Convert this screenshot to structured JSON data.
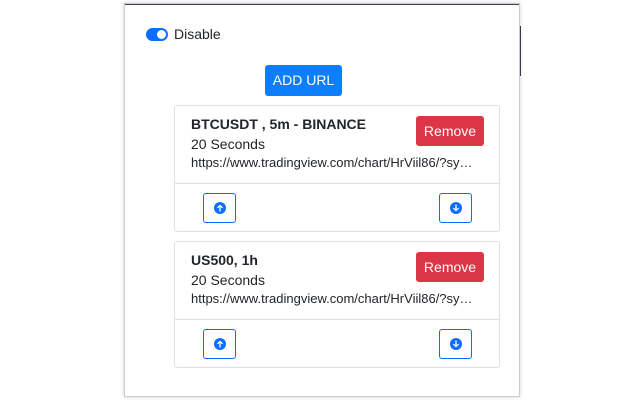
{
  "toggle": {
    "label": "Disable",
    "enabled": true,
    "color": "#0d6efd"
  },
  "add_url": {
    "label": "ADD URL",
    "color": "#0d7efd"
  },
  "cards": [
    {
      "title": "BTCUSDT , 5m - BINANCE",
      "interval": "20 Seconds",
      "url": "https://www.tradingview.com/chart/HrViil86/?sy…",
      "remove_label": "Remove",
      "up_icon": "arrow-up-circle-icon",
      "down_icon": "arrow-down-circle-icon"
    },
    {
      "title": "US500, 1h",
      "interval": "20 Seconds",
      "url": "https://www.tradingview.com/chart/HrViil86/?sy…",
      "remove_label": "Remove",
      "up_icon": "arrow-up-circle-icon",
      "down_icon": "arrow-down-circle-icon"
    }
  ],
  "colors": {
    "remove": "#dc3545",
    "primary": "#0d6efd",
    "border": "#dee2e6"
  }
}
